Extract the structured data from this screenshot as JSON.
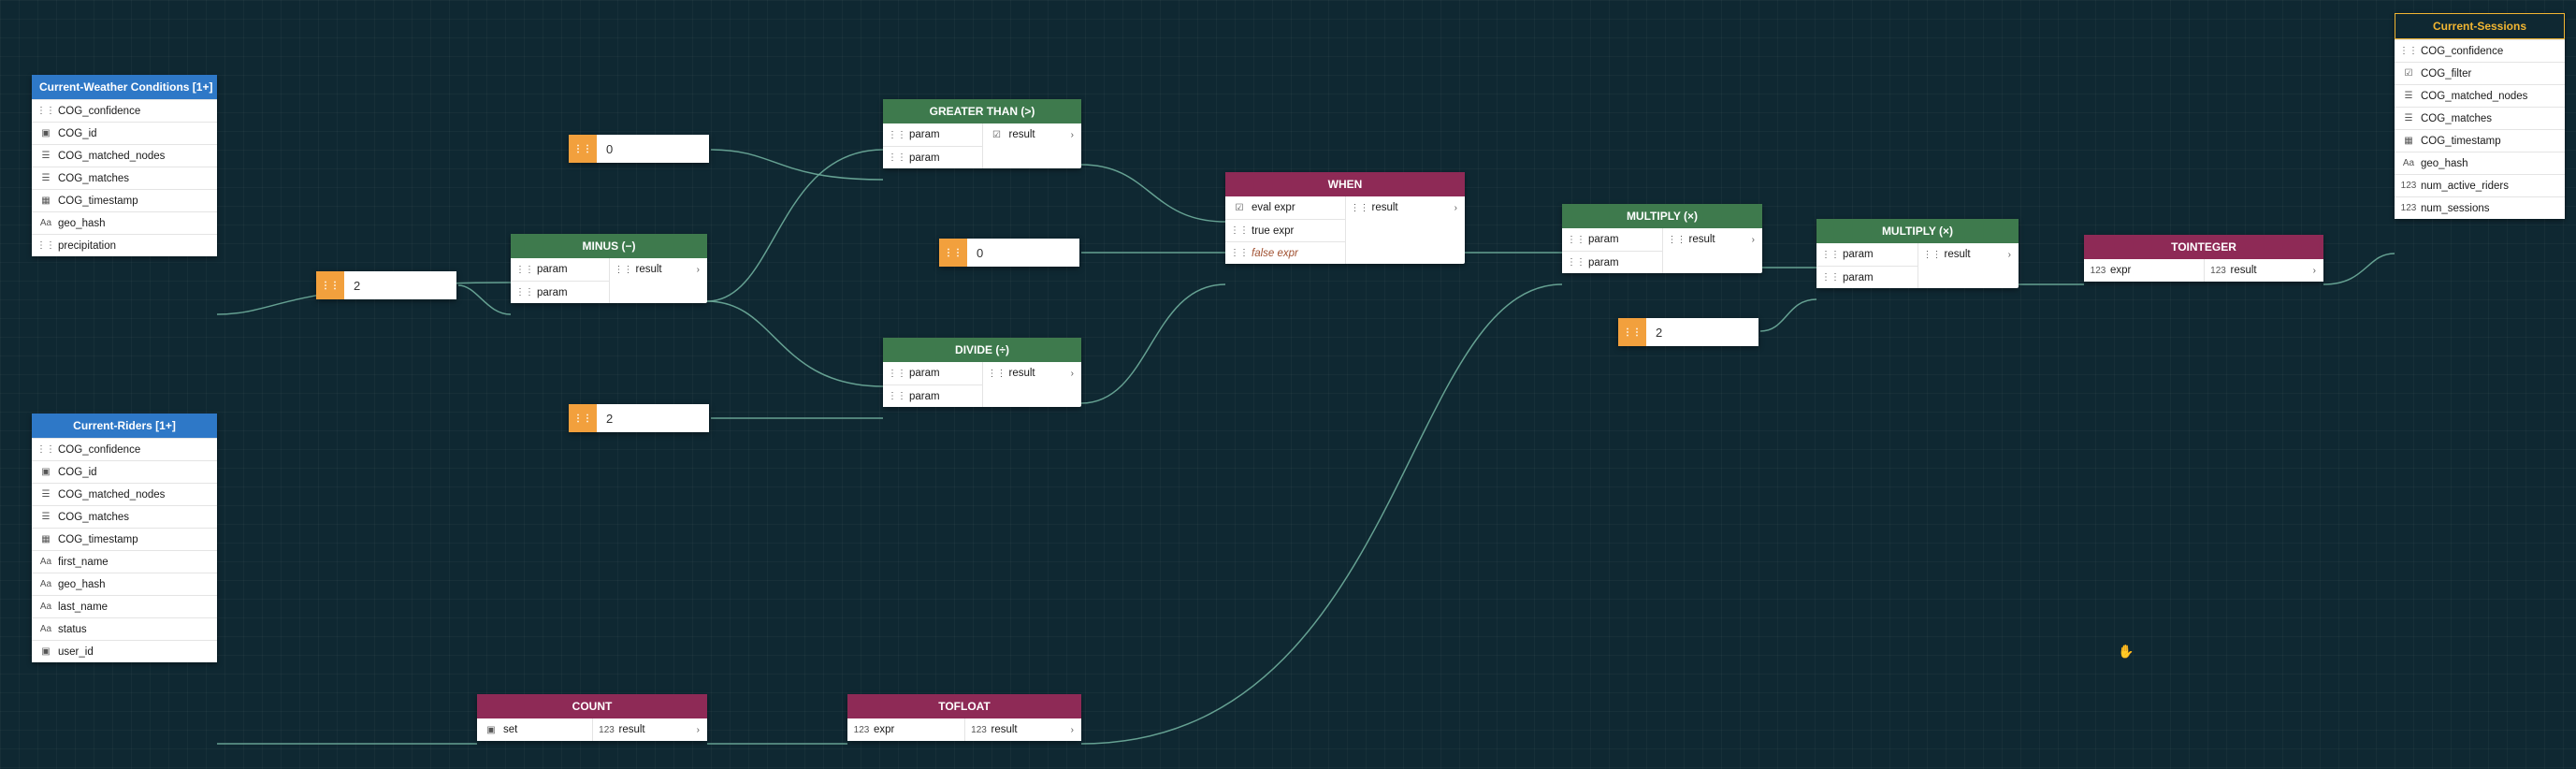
{
  "entities": {
    "weather": {
      "title": "Current-Weather Conditions [1+]",
      "fields": [
        {
          "icon": "tree",
          "label": "COG_confidence"
        },
        {
          "icon": "id",
          "label": "COG_id"
        },
        {
          "icon": "list",
          "label": "COG_matched_nodes"
        },
        {
          "icon": "list",
          "label": "COG_matches"
        },
        {
          "icon": "cal",
          "label": "COG_timestamp"
        },
        {
          "icon": "Aa",
          "label": "geo_hash"
        },
        {
          "icon": "tree",
          "label": "precipitation"
        }
      ]
    },
    "riders": {
      "title": "Current-Riders [1+]",
      "fields": [
        {
          "icon": "tree",
          "label": "COG_confidence"
        },
        {
          "icon": "id",
          "label": "COG_id"
        },
        {
          "icon": "list",
          "label": "COG_matched_nodes"
        },
        {
          "icon": "list",
          "label": "COG_matches"
        },
        {
          "icon": "cal",
          "label": "COG_timestamp"
        },
        {
          "icon": "Aa",
          "label": "first_name"
        },
        {
          "icon": "Aa",
          "label": "geo_hash"
        },
        {
          "icon": "Aa",
          "label": "last_name"
        },
        {
          "icon": "Aa",
          "label": "status"
        },
        {
          "icon": "id",
          "label": "user_id"
        }
      ]
    },
    "sessions": {
      "title": "Current-Sessions",
      "fields": [
        {
          "icon": "tree",
          "label": "COG_confidence"
        },
        {
          "icon": "check",
          "label": "COG_filter"
        },
        {
          "icon": "list",
          "label": "COG_matched_nodes"
        },
        {
          "icon": "list",
          "label": "COG_matches"
        },
        {
          "icon": "cal",
          "label": "COG_timestamp"
        },
        {
          "icon": "Aa",
          "label": "geo_hash"
        },
        {
          "icon": "num",
          "label": "num_active_riders"
        },
        {
          "icon": "num",
          "label": "num_sessions"
        }
      ]
    }
  },
  "ops": {
    "minus": {
      "title": "MINUS (−)",
      "in": [
        "param",
        "param"
      ],
      "out": "result"
    },
    "gt": {
      "title": "GREATER THAN (>)",
      "in": [
        "param",
        "param"
      ],
      "out": "result"
    },
    "divide": {
      "title": "DIVIDE (÷)",
      "in": [
        "param",
        "param"
      ],
      "out": "result"
    },
    "when": {
      "title": "WHEN",
      "in": [
        "eval expr",
        "true expr",
        "false expr"
      ],
      "out": "result",
      "italic_idx": 2,
      "in_icons": [
        "check",
        "tree",
        "tree"
      ]
    },
    "mult1": {
      "title": "MULTIPLY (×)",
      "in": [
        "param",
        "param"
      ],
      "out": "result"
    },
    "mult2": {
      "title": "MULTIPLY (×)",
      "in": [
        "param",
        "param"
      ],
      "out": "result"
    },
    "toint": {
      "title": "TOINTEGER",
      "in": [
        "expr"
      ],
      "out": "result",
      "in_icons": [
        "num"
      ],
      "out_icon": "num"
    },
    "count": {
      "title": "COUNT",
      "in": [
        "set"
      ],
      "out": "result",
      "in_icons": [
        "id"
      ],
      "out_icon": "num"
    },
    "tofloat": {
      "title": "TOFLOAT",
      "in": [
        "expr"
      ],
      "out": "result",
      "in_icons": [
        "num"
      ],
      "out_icon": "num"
    }
  },
  "consts": {
    "c1": "2",
    "c2": "0",
    "c3": "0",
    "c4": "2",
    "c5": "2"
  },
  "icons": {
    "tree": "⋮⋮",
    "id": "▣",
    "list": "☰",
    "cal": "▦",
    "Aa": "Aa",
    "check": "☑",
    "num": "123",
    "arrow": "›"
  }
}
